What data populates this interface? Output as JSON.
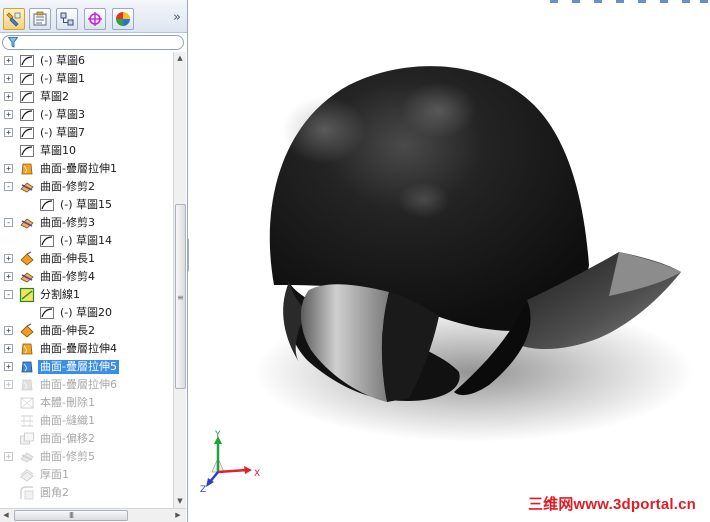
{
  "panel": {
    "tabs": [
      {
        "name": "feature-manager-tab",
        "icon": "feature-tree-icon"
      },
      {
        "name": "property-manager-tab",
        "icon": "property-icon"
      },
      {
        "name": "configuration-manager-tab",
        "icon": "configuration-icon"
      },
      {
        "name": "dimxpert-tab",
        "icon": "crosshair-icon"
      },
      {
        "name": "display-manager-tab",
        "icon": "color-wheel-icon"
      }
    ],
    "collapse_glyph": "»",
    "filter_icon": "filter-funnel-icon"
  },
  "tree": {
    "items": [
      {
        "label": "(-) 草圖6",
        "type": "sketch",
        "indent": 0,
        "expander": "+"
      },
      {
        "label": "(-) 草圖1",
        "type": "sketch",
        "indent": 0,
        "expander": "+"
      },
      {
        "label": "草圖2",
        "type": "sketch",
        "indent": 0,
        "expander": "+"
      },
      {
        "label": "(-) 草圖3",
        "type": "sketch",
        "indent": 0,
        "expander": "+"
      },
      {
        "label": "(-) 草圖7",
        "type": "sketch",
        "indent": 0,
        "expander": "+"
      },
      {
        "label": "草圖10",
        "type": "sketch",
        "indent": 0,
        "expander": ""
      },
      {
        "label": "曲面-疊層拉伸1",
        "type": "loft",
        "indent": 0,
        "expander": "+"
      },
      {
        "label": "曲面-修剪2",
        "type": "trim",
        "indent": 0,
        "expander": "-"
      },
      {
        "label": "(-) 草圖15",
        "type": "sketch",
        "indent": 1,
        "expander": ""
      },
      {
        "label": "曲面-修剪3",
        "type": "trim",
        "indent": 0,
        "expander": "-"
      },
      {
        "label": "(-) 草圖14",
        "type": "sketch",
        "indent": 1,
        "expander": ""
      },
      {
        "label": "曲面-伸長1",
        "type": "extend",
        "indent": 0,
        "expander": "+"
      },
      {
        "label": "曲面-修剪4",
        "type": "trim",
        "indent": 0,
        "expander": "+"
      },
      {
        "label": "分割線1",
        "type": "split",
        "indent": 0,
        "expander": "-"
      },
      {
        "label": "(-) 草圖20",
        "type": "sketch",
        "indent": 1,
        "expander": ""
      },
      {
        "label": "曲面-伸長2",
        "type": "extend",
        "indent": 0,
        "expander": "+"
      },
      {
        "label": "曲面-疊層拉伸4",
        "type": "loft",
        "indent": 0,
        "expander": "+"
      },
      {
        "label": "曲面-疊層拉伸5",
        "type": "loft-blue",
        "indent": 0,
        "expander": "+",
        "selected": true
      },
      {
        "label": "曲面-疊層拉伸6",
        "type": "loft",
        "indent": 0,
        "expander": "+",
        "suppressed": true
      },
      {
        "label": "本體-刪除1",
        "type": "body",
        "indent": 0,
        "expander": "",
        "suppressed": true
      },
      {
        "label": "曲面-縫織1",
        "type": "knit",
        "indent": 0,
        "expander": "",
        "suppressed": true
      },
      {
        "label": "曲面-偏移2",
        "type": "offset",
        "indent": 0,
        "expander": "",
        "suppressed": true
      },
      {
        "label": "曲面-修剪5",
        "type": "trim",
        "indent": 0,
        "expander": "+",
        "suppressed": true
      },
      {
        "label": "厚面1",
        "type": "thicken",
        "indent": 0,
        "expander": "",
        "suppressed": true
      },
      {
        "label": "圓角2",
        "type": "fillet",
        "indent": 0,
        "expander": "",
        "suppressed": true
      }
    ]
  },
  "scrollbars": {
    "horizontal_grip": "III",
    "vertical_grip": "≡"
  },
  "viewport": {
    "model_name": "helmet-surface-model",
    "triad": {
      "x": "X",
      "y": "Y",
      "z": "Z"
    },
    "watermark": "三维网www.3dportal.cn"
  },
  "colors": {
    "selection": "#3a8ee6",
    "suppressed_text": "#a9a9a9",
    "triad_x": "#e0202a",
    "triad_y": "#1fa33a",
    "triad_z": "#2a3fd1",
    "watermark": "#e21c24"
  }
}
